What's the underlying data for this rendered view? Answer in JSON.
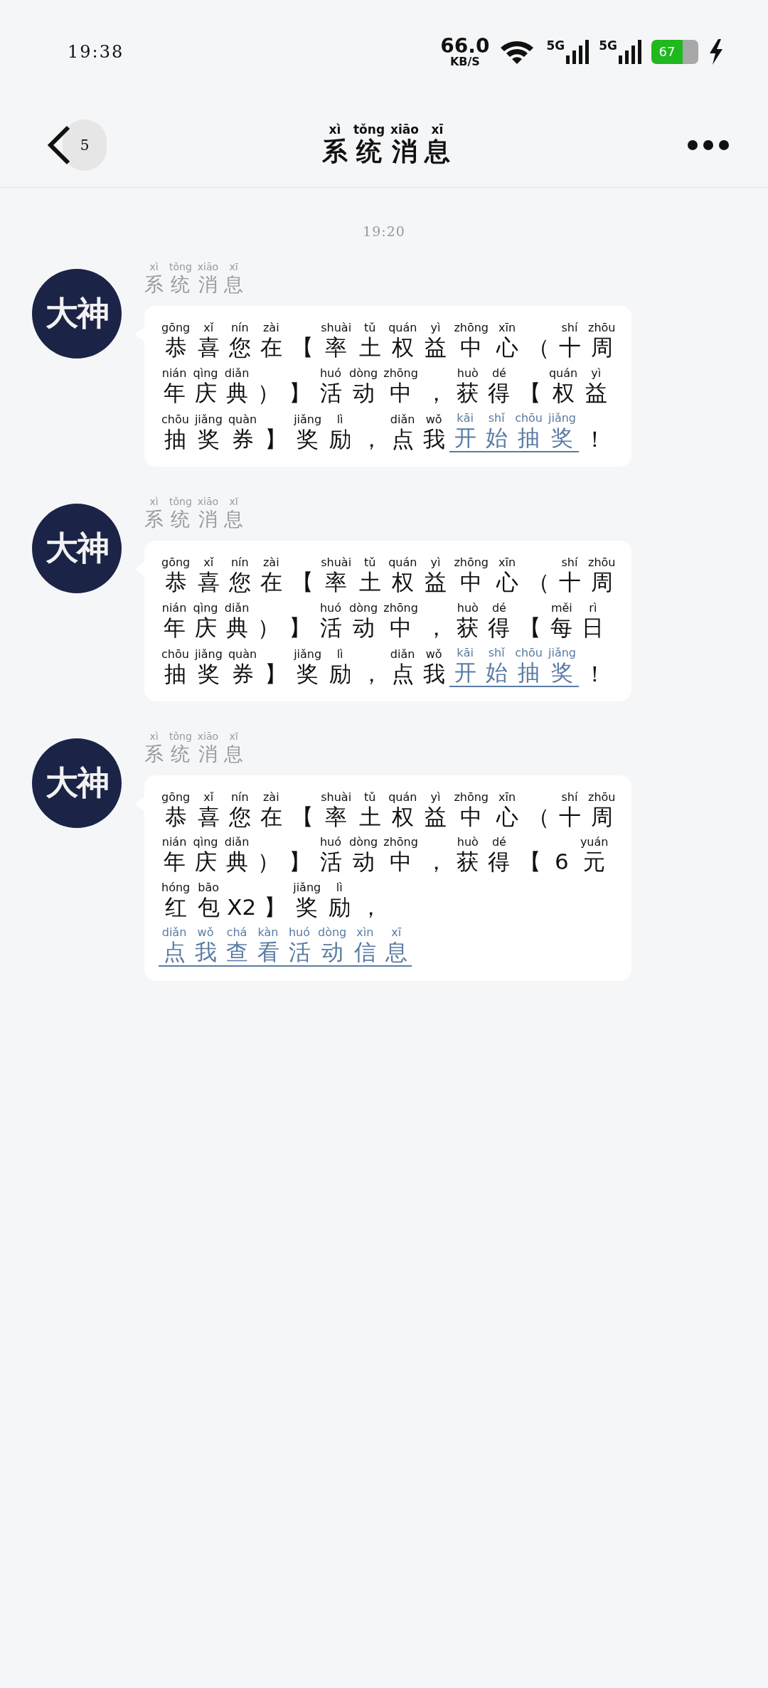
{
  "status_bar": {
    "time": "19:38",
    "speed": "66.0",
    "speed_unit": "KB/S",
    "networks": [
      "5G",
      "5G"
    ],
    "battery": "67"
  },
  "header": {
    "back_badge": "5",
    "title": [
      {
        "text": "系",
        "pinyin": "xì"
      },
      {
        "text": "统",
        "pinyin": "tǒng"
      },
      {
        "text": "消",
        "pinyin": "xiāo"
      },
      {
        "text": "息",
        "pinyin": "xī"
      }
    ]
  },
  "timestamp": "19:20",
  "messages": [
    {
      "avatar_label": "大神",
      "sender": [
        {
          "text": "系",
          "pinyin": "xì"
        },
        {
          "text": "统",
          "pinyin": "tǒng"
        },
        {
          "text": "消",
          "pinyin": "xiāo"
        },
        {
          "text": "息",
          "pinyin": "xī"
        }
      ],
      "segments": [
        {
          "kind": "plain",
          "chars": [
            {
              "text": "恭",
              "pinyin": "gōng"
            },
            {
              "text": "喜",
              "pinyin": "xǐ"
            },
            {
              "text": "您",
              "pinyin": "nín"
            },
            {
              "text": "在",
              "pinyin": "zài"
            },
            {
              "text": "【"
            },
            {
              "text": "率",
              "pinyin": "shuài"
            },
            {
              "text": "土",
              "pinyin": "tǔ"
            },
            {
              "text": "权",
              "pinyin": "quán"
            },
            {
              "text": "益",
              "pinyin": "yì"
            },
            {
              "text": "中",
              "pinyin": "zhōng"
            },
            {
              "text": "心",
              "pinyin": "xīn"
            },
            {
              "text": "（"
            },
            {
              "text": "十",
              "pinyin": "shí"
            },
            {
              "text": "周",
              "pinyin": "zhōu"
            },
            {
              "text": "年",
              "pinyin": "nián"
            },
            {
              "text": "庆",
              "pinyin": "qìng"
            },
            {
              "text": "典",
              "pinyin": "diǎn"
            },
            {
              "text": "）"
            },
            {
              "text": "】"
            },
            {
              "text": "活",
              "pinyin": "huó"
            },
            {
              "text": "动",
              "pinyin": "dòng"
            },
            {
              "text": "中",
              "pinyin": "zhōng"
            },
            {
              "text": "，"
            },
            {
              "text": "获",
              "pinyin": "huò"
            },
            {
              "text": "得",
              "pinyin": "dé"
            },
            {
              "text": "【"
            },
            {
              "text": "权",
              "pinyin": "quán"
            },
            {
              "text": "益",
              "pinyin": "yì"
            },
            {
              "text": "抽",
              "pinyin": "chōu"
            },
            {
              "text": "奖",
              "pinyin": "jiǎng"
            },
            {
              "text": "券",
              "pinyin": "quàn"
            },
            {
              "text": "】"
            },
            {
              "text": "奖",
              "pinyin": "jiǎng"
            },
            {
              "text": "励",
              "pinyin": "lì"
            },
            {
              "text": "，"
            },
            {
              "text": "点",
              "pinyin": "diǎn"
            },
            {
              "text": "我",
              "pinyin": "wǒ"
            }
          ]
        },
        {
          "kind": "link",
          "chars": [
            {
              "text": "开",
              "pinyin": "kāi"
            },
            {
              "text": "始",
              "pinyin": "shǐ"
            },
            {
              "text": "抽",
              "pinyin": "chōu"
            },
            {
              "text": "奖",
              "pinyin": "jiǎng"
            }
          ]
        },
        {
          "kind": "plain",
          "chars": [
            {
              "text": "！"
            }
          ]
        }
      ]
    },
    {
      "avatar_label": "大神",
      "sender": [
        {
          "text": "系",
          "pinyin": "xì"
        },
        {
          "text": "统",
          "pinyin": "tǒng"
        },
        {
          "text": "消",
          "pinyin": "xiāo"
        },
        {
          "text": "息",
          "pinyin": "xī"
        }
      ],
      "segments": [
        {
          "kind": "plain",
          "chars": [
            {
              "text": "恭",
              "pinyin": "gōng"
            },
            {
              "text": "喜",
              "pinyin": "xǐ"
            },
            {
              "text": "您",
              "pinyin": "nín"
            },
            {
              "text": "在",
              "pinyin": "zài"
            },
            {
              "text": "【"
            },
            {
              "text": "率",
              "pinyin": "shuài"
            },
            {
              "text": "土",
              "pinyin": "tǔ"
            },
            {
              "text": "权",
              "pinyin": "quán"
            },
            {
              "text": "益",
              "pinyin": "yì"
            },
            {
              "text": "中",
              "pinyin": "zhōng"
            },
            {
              "text": "心",
              "pinyin": "xīn"
            },
            {
              "text": "（"
            },
            {
              "text": "十",
              "pinyin": "shí"
            },
            {
              "text": "周",
              "pinyin": "zhōu"
            },
            {
              "text": "年",
              "pinyin": "nián"
            },
            {
              "text": "庆",
              "pinyin": "qìng"
            },
            {
              "text": "典",
              "pinyin": "diǎn"
            },
            {
              "text": "）"
            },
            {
              "text": "】"
            },
            {
              "text": "活",
              "pinyin": "huó"
            },
            {
              "text": "动",
              "pinyin": "dòng"
            },
            {
              "text": "中",
              "pinyin": "zhōng"
            },
            {
              "text": "，"
            },
            {
              "text": "获",
              "pinyin": "huò"
            },
            {
              "text": "得",
              "pinyin": "dé"
            },
            {
              "text": "【"
            },
            {
              "text": "每",
              "pinyin": "měi"
            },
            {
              "text": "日",
              "pinyin": "rì"
            },
            {
              "text": "抽",
              "pinyin": "chōu"
            },
            {
              "text": "奖",
              "pinyin": "jiǎng"
            },
            {
              "text": "券",
              "pinyin": "quàn"
            },
            {
              "text": "】"
            },
            {
              "text": "奖",
              "pinyin": "jiǎng"
            },
            {
              "text": "励",
              "pinyin": "lì"
            },
            {
              "text": "，"
            },
            {
              "text": "点",
              "pinyin": "diǎn"
            },
            {
              "text": "我",
              "pinyin": "wǒ"
            }
          ]
        },
        {
          "kind": "link",
          "chars": [
            {
              "text": "开",
              "pinyin": "kāi"
            },
            {
              "text": "始",
              "pinyin": "shǐ"
            },
            {
              "text": "抽",
              "pinyin": "chōu"
            },
            {
              "text": "奖",
              "pinyin": "jiǎng"
            }
          ]
        },
        {
          "kind": "plain",
          "chars": [
            {
              "text": "！"
            }
          ]
        }
      ]
    },
    {
      "avatar_label": "大神",
      "sender": [
        {
          "text": "系",
          "pinyin": "xì"
        },
        {
          "text": "统",
          "pinyin": "tǒng"
        },
        {
          "text": "消",
          "pinyin": "xiāo"
        },
        {
          "text": "息",
          "pinyin": "xī"
        }
      ],
      "segments": [
        {
          "kind": "plain",
          "chars": [
            {
              "text": "恭",
              "pinyin": "gōng"
            },
            {
              "text": "喜",
              "pinyin": "xǐ"
            },
            {
              "text": "您",
              "pinyin": "nín"
            },
            {
              "text": "在",
              "pinyin": "zài"
            },
            {
              "text": "【"
            },
            {
              "text": "率",
              "pinyin": "shuài"
            },
            {
              "text": "土",
              "pinyin": "tǔ"
            },
            {
              "text": "权",
              "pinyin": "quán"
            },
            {
              "text": "益",
              "pinyin": "yì"
            },
            {
              "text": "中",
              "pinyin": "zhōng"
            },
            {
              "text": "心",
              "pinyin": "xīn"
            },
            {
              "text": "（"
            },
            {
              "text": "十",
              "pinyin": "shí"
            },
            {
              "text": "周",
              "pinyin": "zhōu"
            },
            {
              "text": "年",
              "pinyin": "nián"
            },
            {
              "text": "庆",
              "pinyin": "qìng"
            },
            {
              "text": "典",
              "pinyin": "diǎn"
            },
            {
              "text": "）"
            },
            {
              "text": "】"
            },
            {
              "text": "活",
              "pinyin": "huó"
            },
            {
              "text": "动",
              "pinyin": "dòng"
            },
            {
              "text": "中",
              "pinyin": "zhōng"
            },
            {
              "text": "，"
            },
            {
              "text": "获",
              "pinyin": "huò"
            },
            {
              "text": "得",
              "pinyin": "dé"
            },
            {
              "text": "【"
            },
            {
              "text": "6"
            },
            {
              "text": "元",
              "pinyin": "yuán"
            },
            {
              "text": "红",
              "pinyin": "hóng"
            },
            {
              "text": "包",
              "pinyin": "bāo"
            },
            {
              "text": "X2"
            },
            {
              "text": "】"
            },
            {
              "text": "奖",
              "pinyin": "jiǎng"
            },
            {
              "text": "励",
              "pinyin": "lì"
            },
            {
              "text": "，"
            }
          ]
        },
        {
          "kind": "link",
          "chars": [
            {
              "text": "点",
              "pinyin": "diǎn"
            },
            {
              "text": "我",
              "pinyin": "wǒ"
            },
            {
              "text": "查",
              "pinyin": "chá"
            },
            {
              "text": "看",
              "pinyin": "kàn"
            },
            {
              "text": "活",
              "pinyin": "huó"
            },
            {
              "text": "动",
              "pinyin": "dòng"
            },
            {
              "text": "信",
              "pinyin": "xìn"
            },
            {
              "text": "息",
              "pinyin": "xī"
            }
          ]
        }
      ]
    }
  ]
}
